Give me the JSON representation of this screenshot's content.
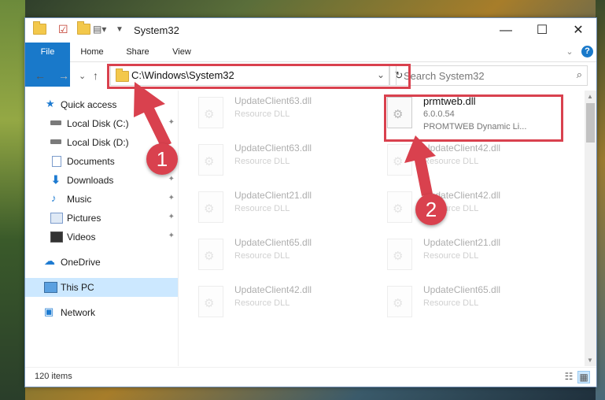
{
  "window": {
    "title": "System32",
    "minimize_glyph": "—",
    "maximize_glyph": "☐",
    "close_glyph": "✕"
  },
  "ribbon": {
    "tabs": [
      "File",
      "Home",
      "Share",
      "View"
    ],
    "expand_glyph": "⌄",
    "help_glyph": "?"
  },
  "navigation": {
    "back_glyph": "←",
    "forward_glyph": "→",
    "recent_glyph": "⌄",
    "up_glyph": "↑",
    "address": "C:\\Windows\\System32",
    "address_dropdown_glyph": "⌄",
    "refresh_glyph": "↻",
    "search_placeholder": "Search System32",
    "search_icon": "search-icon"
  },
  "sidebar": {
    "items": [
      {
        "label": "Quick access",
        "icon": "star-icon",
        "pinned": false
      },
      {
        "label": "Local Disk (C:)",
        "icon": "drive-icon",
        "pinned": true
      },
      {
        "label": "Local Disk (D:)",
        "icon": "drive-icon",
        "pinned": true
      },
      {
        "label": "Documents",
        "icon": "documents-icon",
        "pinned": true
      },
      {
        "label": "Downloads",
        "icon": "download-icon",
        "pinned": true
      },
      {
        "label": "Music",
        "icon": "music-icon",
        "pinned": true
      },
      {
        "label": "Pictures",
        "icon": "pictures-icon",
        "pinned": true
      },
      {
        "label": "Videos",
        "icon": "videos-icon",
        "pinned": true
      },
      {
        "label": "OneDrive",
        "icon": "cloud-icon",
        "pinned": false
      },
      {
        "label": "This PC",
        "icon": "computer-icon",
        "pinned": false,
        "selected": true
      },
      {
        "label": "Network",
        "icon": "network-icon",
        "pinned": false
      }
    ],
    "pin_glyph": "📌"
  },
  "files": [
    {
      "name": "UpdateClient63.dll",
      "type": "Resource DLL",
      "faded": true
    },
    {
      "name": "prmtweb.dll",
      "version": "6.0.0.54",
      "description": "PROMTWEB Dynamic Li...",
      "faded": false
    },
    {
      "name": "UpdateClient63.dll",
      "type": "Resource DLL",
      "faded": true
    },
    {
      "name": "UpdateClient42.dll",
      "type": "Resource DLL",
      "faded": true
    },
    {
      "name": "UpdateClient21.dll",
      "type": "Resource DLL",
      "faded": true
    },
    {
      "name": "UpdateClient42.dll",
      "type": "Resource DLL",
      "faded": true
    },
    {
      "name": "UpdateClient65.dll",
      "type": "Resource DLL",
      "faded": true
    },
    {
      "name": "UpdateClient21.dll",
      "type": "Resource DLL",
      "faded": true
    },
    {
      "name": "UpdateClient42.dll",
      "type": "Resource DLL",
      "faded": true
    },
    {
      "name": "UpdateClient65.dll",
      "type": "Resource DLL",
      "faded": true
    }
  ],
  "status": {
    "item_count": "120 items"
  },
  "callouts": [
    "1",
    "2"
  ],
  "colors": {
    "accent": "#1979ca",
    "highlight": "#d9414e",
    "selection": "#cce8ff"
  }
}
